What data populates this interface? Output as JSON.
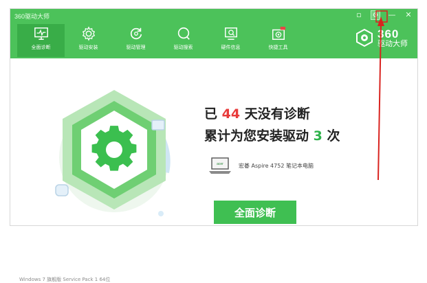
{
  "window": {
    "title": "360驱动大师"
  },
  "toolbar": {
    "items": [
      {
        "label": "全面诊断",
        "icon": "monitor-pulse-icon"
      },
      {
        "label": "驱动安装",
        "icon": "gear-icon"
      },
      {
        "label": "驱动管理",
        "icon": "refresh-icon"
      },
      {
        "label": "驱动搜索",
        "icon": "search-icon"
      },
      {
        "label": "硬件信息",
        "icon": "hardware-monitor-icon"
      },
      {
        "label": "快捷工具",
        "icon": "toolbox-icon"
      }
    ]
  },
  "brand": {
    "number": "360",
    "name": "驱动大师"
  },
  "status": {
    "line1_prefix": "已",
    "days": "44",
    "line1_suffix": "天没有诊断",
    "line2_prefix": "累计为您安装驱动",
    "installs": "3",
    "line2_suffix": "次"
  },
  "device": {
    "name": "宏碁 Aspire 4752 笔记本电脑",
    "icon": "laptop-icon"
  },
  "actions": {
    "diagnose_label": "全面诊断"
  },
  "footer": {
    "os_text": "Windows 7 旗舰版 Service Pack 1 64位"
  },
  "colors": {
    "header_green": "#4cc25a",
    "button_green": "#3fbf52",
    "accent_red": "#e83b3b",
    "accent_green": "#2db24a"
  }
}
